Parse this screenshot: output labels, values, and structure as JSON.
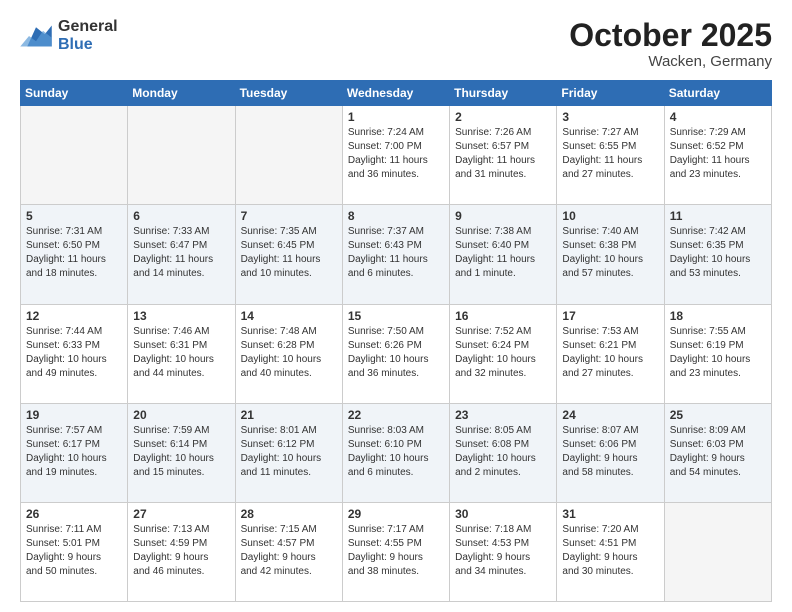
{
  "logo": {
    "general": "General",
    "blue": "Blue"
  },
  "title": "October 2025",
  "subtitle": "Wacken, Germany",
  "days_header": [
    "Sunday",
    "Monday",
    "Tuesday",
    "Wednesday",
    "Thursday",
    "Friday",
    "Saturday"
  ],
  "weeks": [
    {
      "shaded": false,
      "days": [
        {
          "num": "",
          "info": "",
          "empty": true
        },
        {
          "num": "",
          "info": "",
          "empty": true
        },
        {
          "num": "",
          "info": "",
          "empty": true
        },
        {
          "num": "1",
          "info": "Sunrise: 7:24 AM\nSunset: 7:00 PM\nDaylight: 11 hours\nand 36 minutes.",
          "empty": false
        },
        {
          "num": "2",
          "info": "Sunrise: 7:26 AM\nSunset: 6:57 PM\nDaylight: 11 hours\nand 31 minutes.",
          "empty": false
        },
        {
          "num": "3",
          "info": "Sunrise: 7:27 AM\nSunset: 6:55 PM\nDaylight: 11 hours\nand 27 minutes.",
          "empty": false
        },
        {
          "num": "4",
          "info": "Sunrise: 7:29 AM\nSunset: 6:52 PM\nDaylight: 11 hours\nand 23 minutes.",
          "empty": false
        }
      ]
    },
    {
      "shaded": true,
      "days": [
        {
          "num": "5",
          "info": "Sunrise: 7:31 AM\nSunset: 6:50 PM\nDaylight: 11 hours\nand 18 minutes.",
          "empty": false
        },
        {
          "num": "6",
          "info": "Sunrise: 7:33 AM\nSunset: 6:47 PM\nDaylight: 11 hours\nand 14 minutes.",
          "empty": false
        },
        {
          "num": "7",
          "info": "Sunrise: 7:35 AM\nSunset: 6:45 PM\nDaylight: 11 hours\nand 10 minutes.",
          "empty": false
        },
        {
          "num": "8",
          "info": "Sunrise: 7:37 AM\nSunset: 6:43 PM\nDaylight: 11 hours\nand 6 minutes.",
          "empty": false
        },
        {
          "num": "9",
          "info": "Sunrise: 7:38 AM\nSunset: 6:40 PM\nDaylight: 11 hours\nand 1 minute.",
          "empty": false
        },
        {
          "num": "10",
          "info": "Sunrise: 7:40 AM\nSunset: 6:38 PM\nDaylight: 10 hours\nand 57 minutes.",
          "empty": false
        },
        {
          "num": "11",
          "info": "Sunrise: 7:42 AM\nSunset: 6:35 PM\nDaylight: 10 hours\nand 53 minutes.",
          "empty": false
        }
      ]
    },
    {
      "shaded": false,
      "days": [
        {
          "num": "12",
          "info": "Sunrise: 7:44 AM\nSunset: 6:33 PM\nDaylight: 10 hours\nand 49 minutes.",
          "empty": false
        },
        {
          "num": "13",
          "info": "Sunrise: 7:46 AM\nSunset: 6:31 PM\nDaylight: 10 hours\nand 44 minutes.",
          "empty": false
        },
        {
          "num": "14",
          "info": "Sunrise: 7:48 AM\nSunset: 6:28 PM\nDaylight: 10 hours\nand 40 minutes.",
          "empty": false
        },
        {
          "num": "15",
          "info": "Sunrise: 7:50 AM\nSunset: 6:26 PM\nDaylight: 10 hours\nand 36 minutes.",
          "empty": false
        },
        {
          "num": "16",
          "info": "Sunrise: 7:52 AM\nSunset: 6:24 PM\nDaylight: 10 hours\nand 32 minutes.",
          "empty": false
        },
        {
          "num": "17",
          "info": "Sunrise: 7:53 AM\nSunset: 6:21 PM\nDaylight: 10 hours\nand 27 minutes.",
          "empty": false
        },
        {
          "num": "18",
          "info": "Sunrise: 7:55 AM\nSunset: 6:19 PM\nDaylight: 10 hours\nand 23 minutes.",
          "empty": false
        }
      ]
    },
    {
      "shaded": true,
      "days": [
        {
          "num": "19",
          "info": "Sunrise: 7:57 AM\nSunset: 6:17 PM\nDaylight: 10 hours\nand 19 minutes.",
          "empty": false
        },
        {
          "num": "20",
          "info": "Sunrise: 7:59 AM\nSunset: 6:14 PM\nDaylight: 10 hours\nand 15 minutes.",
          "empty": false
        },
        {
          "num": "21",
          "info": "Sunrise: 8:01 AM\nSunset: 6:12 PM\nDaylight: 10 hours\nand 11 minutes.",
          "empty": false
        },
        {
          "num": "22",
          "info": "Sunrise: 8:03 AM\nSunset: 6:10 PM\nDaylight: 10 hours\nand 6 minutes.",
          "empty": false
        },
        {
          "num": "23",
          "info": "Sunrise: 8:05 AM\nSunset: 6:08 PM\nDaylight: 10 hours\nand 2 minutes.",
          "empty": false
        },
        {
          "num": "24",
          "info": "Sunrise: 8:07 AM\nSunset: 6:06 PM\nDaylight: 9 hours\nand 58 minutes.",
          "empty": false
        },
        {
          "num": "25",
          "info": "Sunrise: 8:09 AM\nSunset: 6:03 PM\nDaylight: 9 hours\nand 54 minutes.",
          "empty": false
        }
      ]
    },
    {
      "shaded": false,
      "days": [
        {
          "num": "26",
          "info": "Sunrise: 7:11 AM\nSunset: 5:01 PM\nDaylight: 9 hours\nand 50 minutes.",
          "empty": false
        },
        {
          "num": "27",
          "info": "Sunrise: 7:13 AM\nSunset: 4:59 PM\nDaylight: 9 hours\nand 46 minutes.",
          "empty": false
        },
        {
          "num": "28",
          "info": "Sunrise: 7:15 AM\nSunset: 4:57 PM\nDaylight: 9 hours\nand 42 minutes.",
          "empty": false
        },
        {
          "num": "29",
          "info": "Sunrise: 7:17 AM\nSunset: 4:55 PM\nDaylight: 9 hours\nand 38 minutes.",
          "empty": false
        },
        {
          "num": "30",
          "info": "Sunrise: 7:18 AM\nSunset: 4:53 PM\nDaylight: 9 hours\nand 34 minutes.",
          "empty": false
        },
        {
          "num": "31",
          "info": "Sunrise: 7:20 AM\nSunset: 4:51 PM\nDaylight: 9 hours\nand 30 minutes.",
          "empty": false
        },
        {
          "num": "",
          "info": "",
          "empty": true
        }
      ]
    }
  ]
}
